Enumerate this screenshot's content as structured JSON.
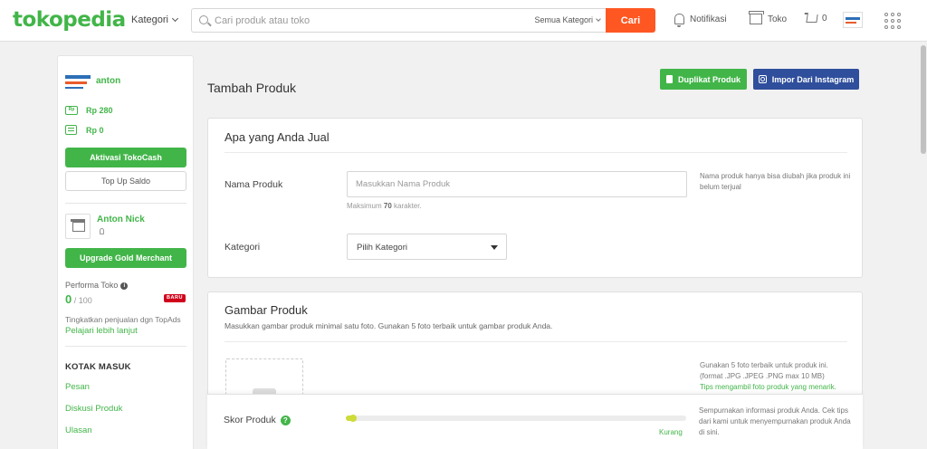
{
  "header": {
    "logo": "tokopedia",
    "category_nav": "Kategori",
    "search_placeholder": "Cari produk atau toko",
    "search_category": "Semua Kategori",
    "search_button": "Cari",
    "notifications": "Notifikasi",
    "shop": "Toko",
    "cart_count": "0",
    "icons": [
      "bell-icon",
      "shop-icon",
      "cart-icon",
      "apps-grid-icon"
    ]
  },
  "sidebar": {
    "user_name": "anton",
    "balance_tokocash": "Rp 280",
    "balance_saldo": "Rp 0",
    "activate_button": "Aktivasi TokoCash",
    "topup_button": "Top Up Saldo",
    "shop_name": "Anton Nick",
    "upgrade_button": "Upgrade Gold Merchant",
    "performance_label": "Performa Toko",
    "performance_score": "0",
    "performance_max": "/ 100",
    "new_badge": "BARU",
    "tip_text": "Tingkatkan penjualan dgn TopAds",
    "learn_more": "Pelajari lebih lanjut",
    "inbox_heading": "KOTAK MASUK",
    "inbox_items": [
      "Pesan",
      "Diskusi Produk",
      "Ulasan"
    ]
  },
  "main": {
    "title": "Tambah Produk",
    "duplicate_button": "Duplikat Produk",
    "instagram_button": "Impor Dari Instagram",
    "section1": {
      "title": "Apa yang Anda Jual",
      "name_label": "Nama Produk",
      "name_placeholder": "Masukkan Nama Produk",
      "name_hint_prefix": "Maksimum ",
      "name_hint_count": "70",
      "name_hint_suffix": " karakter.",
      "name_note": "Nama produk hanya bisa diubah jika produk ini belum terjual",
      "category_label": "Kategori",
      "category_value": "Pilih Kategori"
    },
    "section2": {
      "title": "Gambar Produk",
      "subtitle": "Masukkan gambar produk minimal satu foto. Gunakan 5 foto terbaik untuk gambar produk Anda.",
      "note_line1": "Gunakan 5 foto terbaik untuk produk ini.",
      "note_line2": "(format .JPG .JPEG .PNG max 10 MB)",
      "note_link": "Tips mengambil foto produk yang menarik."
    },
    "score": {
      "label": "Skor Produk",
      "status": "Kurang",
      "progress": 0.02,
      "note": "Sempurnakan informasi produk Anda. Cek tips dari kami untuk menyempurnakan produk Anda di sini."
    }
  },
  "colors": {
    "brand_green": "#42b549",
    "search_orange": "#ff5722",
    "instagram_blue": "#2f4f9c",
    "badge_red": "#d0021b",
    "score_lime": "#cddc39"
  }
}
